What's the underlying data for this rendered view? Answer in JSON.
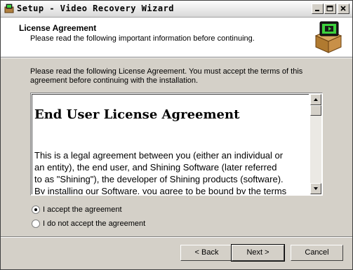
{
  "window": {
    "title": "Setup - Video Recovery Wizard"
  },
  "header": {
    "title": "License Agreement",
    "subtitle": "Please read the following important information before continuing."
  },
  "intro": "Please read the following License Agreement. You must accept the terms of this agreement before continuing with the installation.",
  "license": {
    "heading": "End User License Agreement",
    "lines": [
      "This is a legal agreement between you (either an individual or",
      "an entity), the end user, and Shining  Software (later referred",
      "to as \"Shining\"), the developer of Shining  products (software).",
      "By installing our Software, you agree to be bound by the terms"
    ]
  },
  "options": {
    "accept": "I accept the agreement",
    "decline": "I do not accept the agreement",
    "selected": "accept"
  },
  "buttons": {
    "back": "< Back",
    "next": "Next >",
    "cancel": "Cancel"
  },
  "icons": {
    "app": "setup-box-icon",
    "minimize": "minimize-icon",
    "maximize": "maximize-icon",
    "close": "close-icon",
    "header": "setup-box-icon"
  }
}
